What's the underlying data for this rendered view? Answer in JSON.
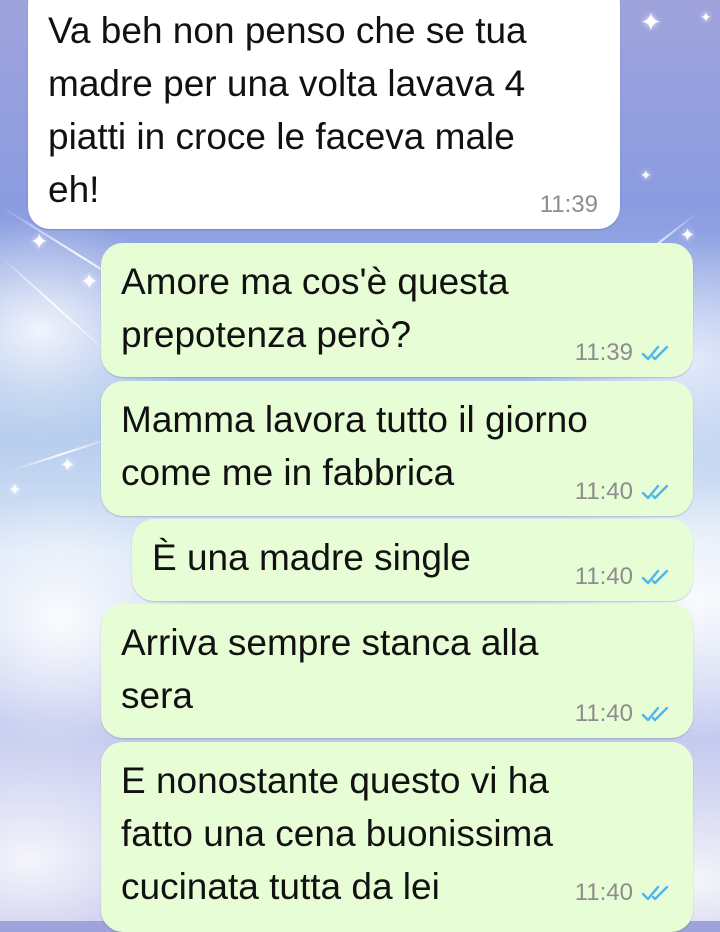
{
  "messages": [
    {
      "direction": "incoming",
      "text": "Va beh non penso che se tua\nmadre per una volta lavava 4\npiatti in croce le faceva male\neh!",
      "time": "11:39"
    },
    {
      "direction": "outgoing",
      "text": "Amore ma cos'è questa\nprepotenza però?",
      "time": "11:39",
      "status": "read"
    },
    {
      "direction": "outgoing",
      "text": "Mamma lavora tutto il giorno\ncome me in fabbrica",
      "time": "11:40",
      "status": "read"
    },
    {
      "direction": "outgoing",
      "text": "È una madre single",
      "time": "11:40",
      "status": "read"
    },
    {
      "direction": "outgoing",
      "text": "Arriva sempre stanca alla\nsera",
      "time": "11:40",
      "status": "read"
    },
    {
      "direction": "outgoing",
      "text": "E nonostante questo vi ha\nfatto una cena buonissima\ncucinata tutta da lei",
      "time": "11:40",
      "status": "read"
    }
  ],
  "colors": {
    "incoming_bubble": "#ffffff",
    "outgoing_bubble": "#e7fdd6",
    "read_ticks": "#4fb6ec",
    "timestamp": "#8d8d8d"
  },
  "icons": {
    "read_receipt": "double-check-icon",
    "decoration": "sparkle-icon"
  }
}
